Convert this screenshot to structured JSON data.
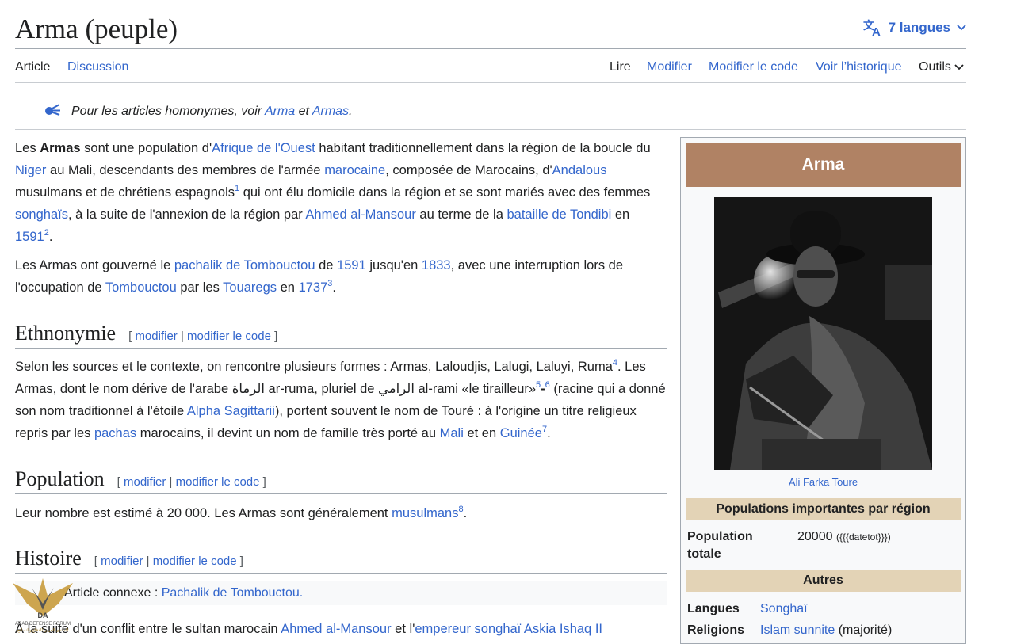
{
  "page": {
    "title": "Arma (peuple)",
    "languages_label": "7 langues"
  },
  "tabs": {
    "article": "Article",
    "discussion": "Discussion",
    "read": "Lire",
    "edit": "Modifier",
    "edit_source": "Modifier le code",
    "history": "Voir l’historique",
    "tools": "Outils"
  },
  "hatnote": {
    "prefix": "Pour les articles homonymes, voir ",
    "link1": "Arma",
    "middle": " et ",
    "link2": "Armas",
    "suffix": "."
  },
  "intro": {
    "p1": [
      {
        "t": "Les "
      },
      {
        "t": "Armas",
        "b": true
      },
      {
        "t": " sont une population d'"
      },
      {
        "t": "Afrique de l'Ouest",
        "l": true
      },
      {
        "t": " habitant traditionnellement dans la région de la boucle du "
      },
      {
        "t": "Niger",
        "l": true
      },
      {
        "t": " au Mali, descendants des membres de l'armée "
      },
      {
        "t": "marocaine",
        "l": true
      },
      {
        "t": ", composée de Marocains, d'"
      },
      {
        "t": "Andalous",
        "l": true
      },
      {
        "t": " musulmans et de chrétiens espagnols"
      },
      {
        "t": "1",
        "s": true
      },
      {
        "t": " qui ont élu domicile dans la région et se sont mariés avec des femmes "
      },
      {
        "t": "songhaïs",
        "l": true
      },
      {
        "t": ", à la suite de l'annexion de la région par "
      },
      {
        "t": "Ahmed al-Mansour",
        "l": true
      },
      {
        "t": " au terme de la "
      },
      {
        "t": "bataille de Tondibi",
        "l": true
      },
      {
        "t": " en "
      },
      {
        "t": "1591",
        "l": true
      },
      {
        "t": "2",
        "s": true
      },
      {
        "t": "."
      }
    ],
    "p2": [
      {
        "t": "Les Armas ont gouverné le "
      },
      {
        "t": "pachalik de Tombouctou",
        "l": true
      },
      {
        "t": " de "
      },
      {
        "t": "1591",
        "l": true
      },
      {
        "t": " jusqu'en "
      },
      {
        "t": "1833",
        "l": true
      },
      {
        "t": ", avec une interruption lors de l'occupation de "
      },
      {
        "t": "Tombouctou",
        "l": true
      },
      {
        "t": " par les "
      },
      {
        "t": "Touaregs",
        "l": true
      },
      {
        "t": " en "
      },
      {
        "t": "1737",
        "l": true
      },
      {
        "t": "3",
        "s": true
      },
      {
        "t": "."
      }
    ]
  },
  "section_edit": {
    "open": "[ ",
    "modifier": "modifier",
    "sep": " | ",
    "modifier_code": "modifier le code",
    "close": " ]"
  },
  "ethnonymie": {
    "title": "Ethnonymie",
    "p": [
      {
        "t": "Selon les sources et le contexte, on rencontre plusieurs formes : Armas, Laloudjis, Lalugi, Laluyi, Ruma"
      },
      {
        "t": "4",
        "s": true
      },
      {
        "t": ". Les Armas, dont le nom dérive de l'arabe الرماة ar-ruma, pluriel de الرامي al-rami «le tirailleur»"
      },
      {
        "t": "5",
        "s": true
      },
      {
        "t": "-",
        "b": true
      },
      {
        "t": "6",
        "s": true
      },
      {
        "t": " (racine qui a donné son nom traditionnel à l'étoile "
      },
      {
        "t": "Alpha Sagittarii",
        "l": true
      },
      {
        "t": "), portent souvent le nom de Touré : à l'origine un titre religieux repris par les "
      },
      {
        "t": "pachas",
        "l": true
      },
      {
        "t": " marocains, il devint un nom de famille très porté au "
      },
      {
        "t": "Mali",
        "l": true
      },
      {
        "t": " et en "
      },
      {
        "t": "Guinée",
        "l": true
      },
      {
        "t": "7",
        "s": true
      },
      {
        "t": "."
      }
    ]
  },
  "population": {
    "title": "Population",
    "p": [
      {
        "t": "Leur nombre est estimé à 20 000. Les Armas sont généralement "
      },
      {
        "t": "musulmans",
        "l": true
      },
      {
        "t": "8",
        "s": true
      },
      {
        "t": "."
      }
    ]
  },
  "histoire": {
    "title": "Histoire",
    "connexe_label": "Article connexe : ",
    "connexe_link": "Pachalik de Tombouctou.",
    "p": [
      {
        "t": "À la suite d'un conflit entre le sultan marocain "
      },
      {
        "t": "Ahmed al-Mansour",
        "l": true
      },
      {
        "t": " et l'"
      },
      {
        "t": "empereur songhaï Askia Ishaq II",
        "l": true
      }
    ]
  },
  "infobox": {
    "title": "Arma",
    "caption": "Ali Farka Toure",
    "section1": "Populations importantes par région",
    "pop_label": "Population totale",
    "pop_value": "20000",
    "pop_note": "({{{datetot}}})",
    "section2": "Autres",
    "lang_label": "Langues",
    "lang_value": "Songhaï",
    "rel_label": "Religions",
    "rel_value": "Islam sunnite",
    "rel_note": " (majorité)"
  },
  "watermark": {
    "line1": "ARAB DEFENSE FORUM",
    "line2": "المنتدى العربي للدفاع والتسليح"
  },
  "colors": {
    "link": "#3366cc",
    "infobox_title_bg": "#b08264",
    "infobox_section_bg": "#e3d3b6"
  }
}
